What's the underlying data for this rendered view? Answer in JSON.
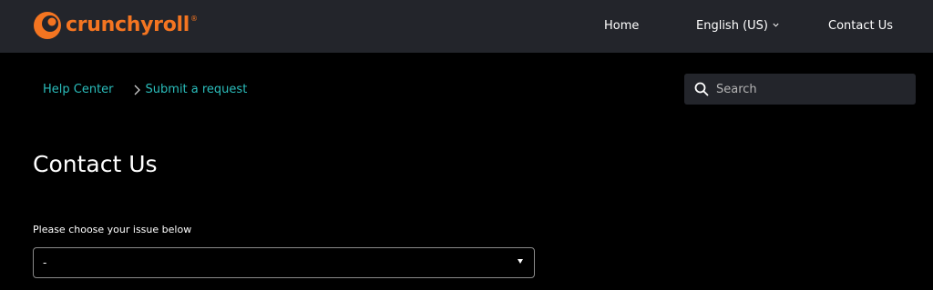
{
  "header": {
    "logo": {
      "text": "crunchyroll",
      "registered_mark": "®",
      "icon": "crunchyroll-logo-icon",
      "brand_color": "#f47521"
    },
    "nav": {
      "home": "Home",
      "language": "English (US)",
      "language_icon": "chevron-down-icon",
      "contact": "Contact Us"
    },
    "background": "#23252b"
  },
  "breadcrumb": {
    "items": [
      "Help Center",
      "Submit a request"
    ],
    "separator_icon": "chevron-right-icon",
    "link_color": "#2abdbb"
  },
  "search": {
    "placeholder": "Search",
    "icon": "search-icon"
  },
  "main": {
    "title": "Contact Us",
    "issue_label": "Please choose your issue below",
    "issue_select": {
      "value": "-",
      "icon": "caret-down-icon"
    }
  }
}
